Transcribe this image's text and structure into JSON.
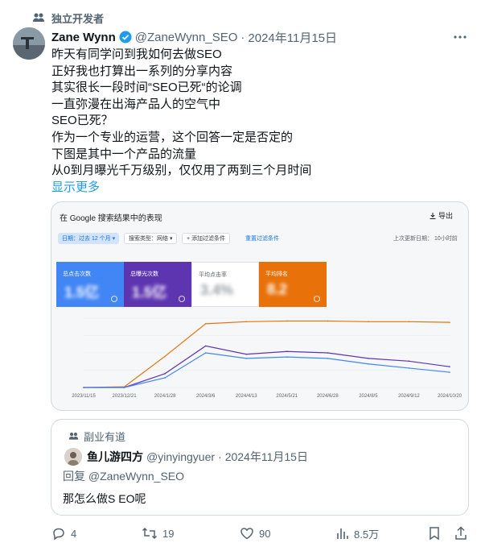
{
  "community": {
    "label": "独立开发者",
    "icon": "community-icon"
  },
  "post": {
    "author_name": "Zane Wynn",
    "handle": "@ZaneWynn_SEO",
    "separator": "·",
    "date": "2024年11月15日",
    "lines": [
      "昨天有同学问到我如何去做SEO",
      "正好我也打算出一系列的分享内容",
      "其实很长一段时间“SEO已死“的论调",
      "一直弥漫在出海产品人的空气中",
      "SEO已死？",
      "作为一个专业的运营，这个回答一定是否定的",
      "下图是其中一个产品的流量",
      "从0到月曝光千万级别，仅仅用了两到三个月时间"
    ],
    "show_more": "显示更多"
  },
  "card": {
    "title": "在 Google 搜索结果中的表现",
    "export": "导出",
    "filters": {
      "date": "日期：过去 12 个月 ▾",
      "type": "搜索类型：网络 ▾",
      "add": "+ 添加过滤条件",
      "reset": "重置过滤条件",
      "updated": "上次更新日期：   10小时前"
    },
    "metrics": [
      {
        "label": "总点击次数",
        "value": "1.5亿"
      },
      {
        "label": "总曝光次数",
        "value": "1.5亿"
      },
      {
        "label": "平均点击率",
        "value": "3.4%"
      },
      {
        "label": "平均排名",
        "value": "8.2"
      }
    ],
    "colors": {
      "clicks": "#4285f4",
      "impressions": "#5e35b1",
      "position": "#e8710a"
    }
  },
  "chart_data": {
    "type": "line",
    "x": [
      "2023/11/15",
      "2023/12/21",
      "2024/1/28",
      "2024/3/6",
      "2024/4/13",
      "2024/5/21",
      "2024/6/28",
      "2024/8/5",
      "2024/9/12",
      "2024/10/20"
    ],
    "series": [
      {
        "values": [
          0,
          1,
          45,
          92,
          95,
          96,
          96,
          95,
          95,
          94
        ],
        "color": "#e8710a"
      },
      {
        "values": [
          0,
          0,
          20,
          60,
          48,
          52,
          50,
          42,
          38,
          30
        ],
        "color": "#5e35b1"
      },
      {
        "values": [
          0,
          0,
          14,
          50,
          42,
          44,
          42,
          34,
          28,
          22
        ],
        "color": "#4285f4"
      }
    ],
    "grid": true
  },
  "quote": {
    "community": "副业有道",
    "author_name": "鱼儿游四方",
    "handle": "@yinyingyuer",
    "separator": "·",
    "date": "2024年11月15日",
    "reply_to": "回复 @ZaneWynn_SEO",
    "text": "那怎么做S EO呢"
  },
  "actions": {
    "replies": "4",
    "retweets": "19",
    "likes": "90",
    "views": "8.5万"
  }
}
